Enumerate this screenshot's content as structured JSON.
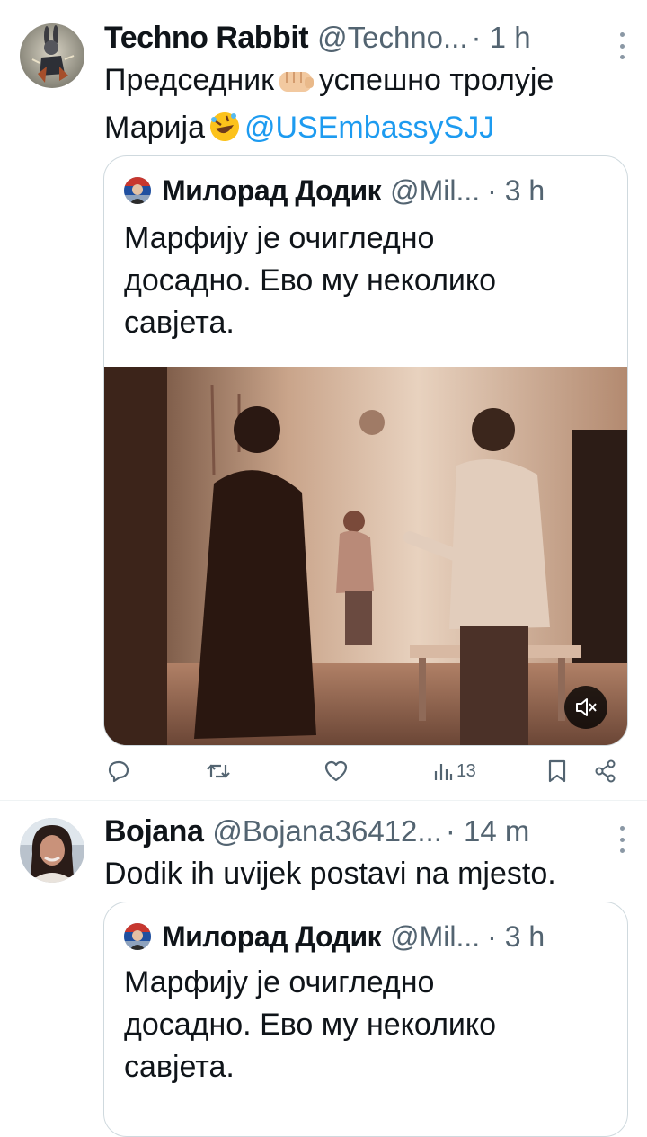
{
  "tweets": [
    {
      "name": "Techno Rabbit",
      "handle": "@Techno...",
      "time": "· 1 h",
      "text_part1": "Председник",
      "text_part2": "успешно тролује",
      "text_part3": "Марија",
      "mention": "@USEmbassySJJ",
      "quote": {
        "name": "Милорад Додик",
        "handle": "@Mil...",
        "time": "· 3 h",
        "text_line1": "Марфију је очигледно",
        "text_line2": "досадно. Ево му неколико",
        "text_line3": "савјета."
      },
      "views": "13"
    },
    {
      "name": "Bojana",
      "handle": "@Bojana36412...",
      "time": "· 14 m",
      "text": "Dodik ih uvijek postavi na mjesto.",
      "quote": {
        "name": "Милорад Додик",
        "handle": "@Mil...",
        "time": "· 3 h",
        "text_line1": "Марфију је очигледно",
        "text_line2": "досадно. Ево му неколико",
        "text_line3": "савјета."
      }
    }
  ],
  "icons": {
    "reply": "reply-icon",
    "retweet": "retweet-icon",
    "like": "heart-icon",
    "views": "views-icon",
    "bookmark": "bookmark-icon",
    "share": "share-icon",
    "mute": "muted-speaker-icon"
  },
  "colors": {
    "accent": "#1d9bf0",
    "muted_text": "#536471",
    "border": "#cfd9de"
  }
}
